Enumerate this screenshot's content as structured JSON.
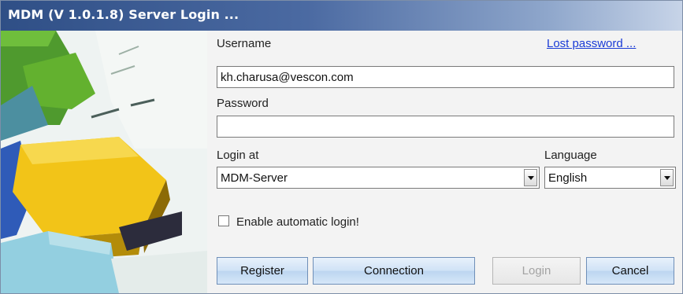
{
  "window": {
    "title": "MDM (V 1.0.1.8) Server Login ..."
  },
  "form": {
    "username_label": "Username",
    "lost_password_link": "Lost password ...",
    "username_value": "kh.charusa@vescon.com",
    "password_label": "Password",
    "password_value": "",
    "login_at_label": "Login at",
    "login_at_value": "MDM-Server",
    "language_label": "Language",
    "language_value": "English",
    "auto_login_label": "Enable automatic login!",
    "auto_login_checked": false
  },
  "buttons": {
    "register": "Register",
    "connection": "Connection",
    "login": "Login",
    "cancel": "Cancel"
  },
  "icons": [
    "chevron-down-icon"
  ],
  "colors": {
    "titlebar": "#2f4f86",
    "link": "#1a3bd6",
    "button": "#cfe2f6"
  }
}
